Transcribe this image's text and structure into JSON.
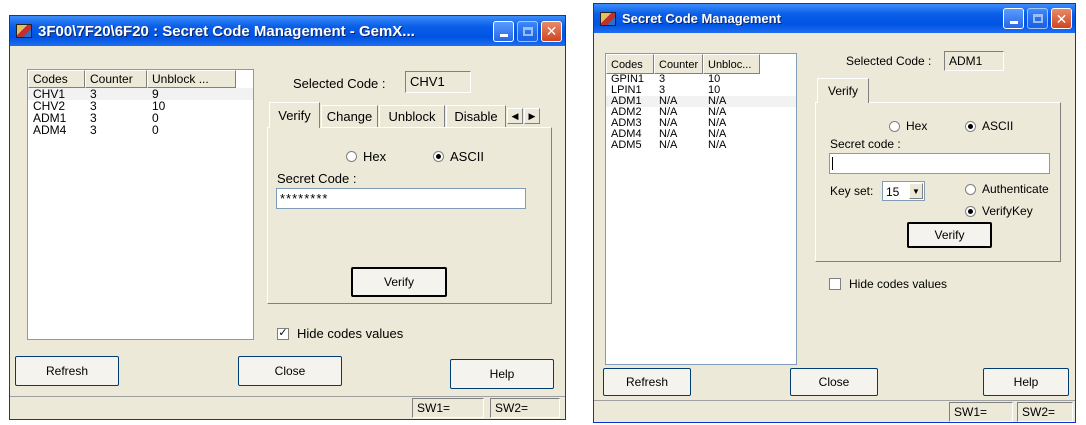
{
  "left": {
    "title": "3F00\\7F20\\6F20 : Secret Code Management - GemX...",
    "selected_label": "Selected Code :",
    "selected_value": "CHV1",
    "columns": [
      "Codes",
      "Counter",
      "Unblock ..."
    ],
    "rows": [
      {
        "code": "CHV1",
        "counter": "3",
        "unblock": "9"
      },
      {
        "code": "CHV2",
        "counter": "3",
        "unblock": "10"
      },
      {
        "code": "ADM1",
        "counter": "3",
        "unblock": "0"
      },
      {
        "code": "ADM4",
        "counter": "3",
        "unblock": "0"
      }
    ],
    "tabs": [
      "Verify",
      "Change",
      "Unblock",
      "Disable"
    ],
    "radio_hex": "Hex",
    "radio_ascii": "ASCII",
    "secret_label": "Secret Code :",
    "secret_value": "********",
    "verify_label": "Verify",
    "hide_label": "Hide codes values",
    "hide_checked": true,
    "refresh_label": "Refresh",
    "close_label": "Close",
    "help_label": "Help",
    "sw1": "SW1=",
    "sw2": "SW2="
  },
  "right": {
    "title": "Secret Code Management",
    "selected_label": "Selected Code :",
    "selected_value": "ADM1",
    "columns": [
      "Codes",
      "Counter",
      "Unbloc..."
    ],
    "rows": [
      {
        "code": "GPIN1",
        "counter": "3",
        "unblock": "10"
      },
      {
        "code": "LPIN1",
        "counter": "3",
        "unblock": "10"
      },
      {
        "code": "ADM1",
        "counter": "N/A",
        "unblock": "N/A"
      },
      {
        "code": "ADM2",
        "counter": "N/A",
        "unblock": "N/A"
      },
      {
        "code": "ADM3",
        "counter": "N/A",
        "unblock": "N/A"
      },
      {
        "code": "ADM4",
        "counter": "N/A",
        "unblock": "N/A"
      },
      {
        "code": "ADM5",
        "counter": "N/A",
        "unblock": "N/A"
      }
    ],
    "tab": "Verify",
    "radio_hex": "Hex",
    "radio_ascii": "ASCII",
    "secret_label": "Secret code :",
    "secret_value": "",
    "keyset_label": "Key set:",
    "keyset_value": "15",
    "radio_authenticate": "Authenticate",
    "radio_verifykey": "VerifyKey",
    "verify_label": "Verify",
    "hide_label": "Hide codes values",
    "hide_checked": false,
    "refresh_label": "Refresh",
    "close_label": "Close",
    "help_label": "Help",
    "sw1": "SW1=",
    "sw2": "SW2="
  }
}
